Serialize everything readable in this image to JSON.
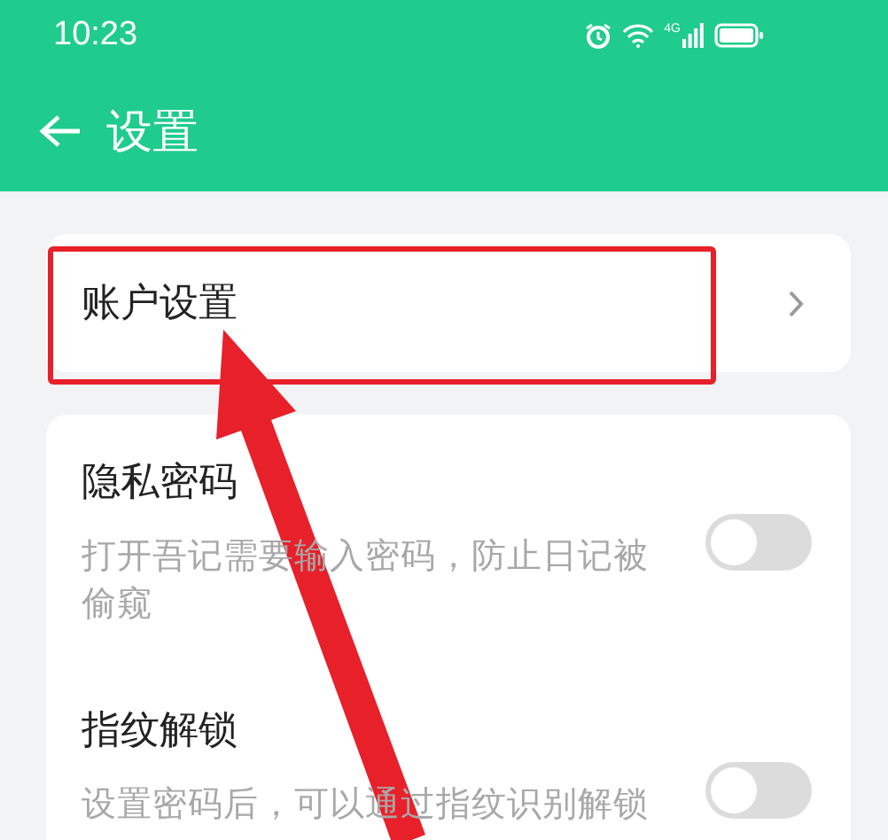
{
  "status_bar": {
    "time": "10:23",
    "network_type": "4G"
  },
  "header": {
    "title": "设置"
  },
  "account_row": {
    "label": "账户设置"
  },
  "settings": [
    {
      "title": "隐私密码",
      "description": "打开吾记需要输入密码，防止日记被偷窥",
      "on": false
    },
    {
      "title": "指纹解锁",
      "description": "设置密码后，可以通过指纹识别解锁",
      "on": false
    }
  ]
}
